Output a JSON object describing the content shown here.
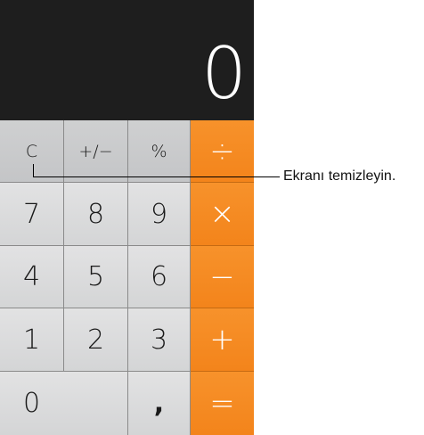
{
  "display": {
    "value": "0"
  },
  "keys": {
    "clear": "C",
    "sign": "+/−",
    "percent": "%",
    "divide": "÷",
    "seven": "7",
    "eight": "8",
    "nine": "9",
    "multiply": "×",
    "four": "4",
    "five": "5",
    "six": "6",
    "minus": "−",
    "one": "1",
    "two": "2",
    "three": "3",
    "plus": "+",
    "zero": "0",
    "decimal": ",",
    "equals": "="
  },
  "callout": {
    "text": "Ekranı temizleyin."
  },
  "colors": {
    "operator": "#f3841b",
    "function_key": "#c9cacc",
    "number_key": "#dcdcdd",
    "display_bg": "#1e1e1e"
  }
}
